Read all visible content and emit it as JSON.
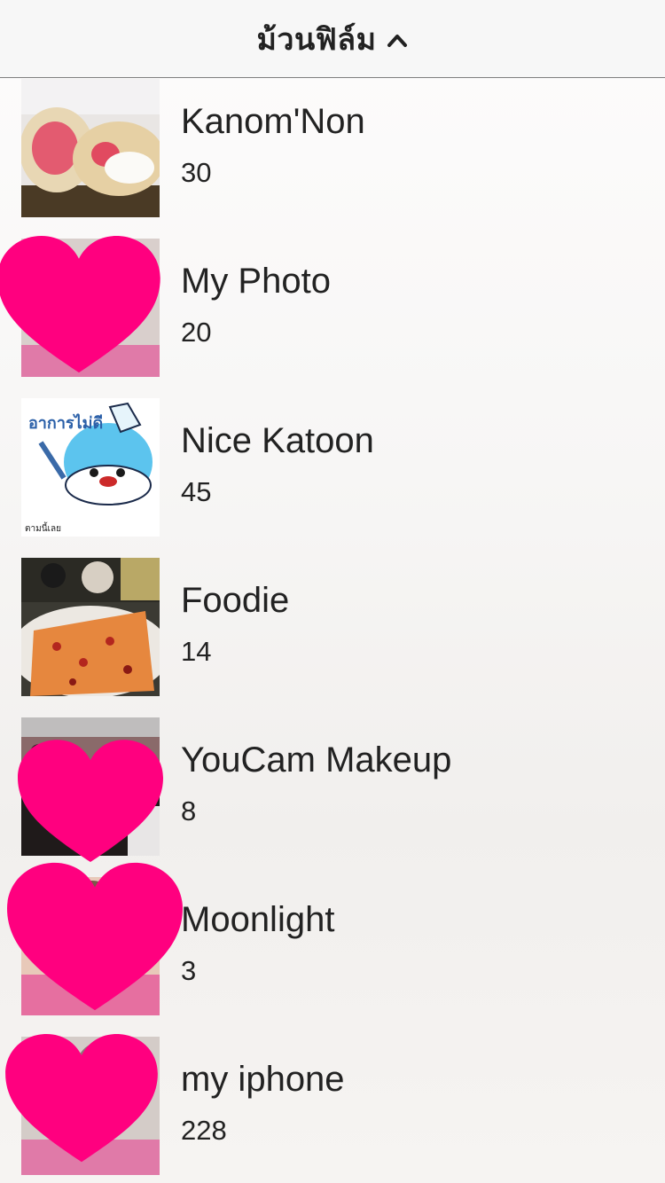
{
  "header": {
    "title": "ม้วนฟิล์ม",
    "chevron_icon": "chevron-up-icon"
  },
  "albums": [
    {
      "name": "Kanom'Non",
      "count": "30",
      "thumb_icon": "cake-photo"
    },
    {
      "name": "My Photo",
      "count": "20",
      "thumb_icon": "portrait-photo"
    },
    {
      "name": "Nice Katoon",
      "count": "45",
      "thumb_icon": "cartoon-sticker",
      "sticker_text": "อาการไม่ดี",
      "sticker_caption": "ตามนี้เลย"
    },
    {
      "name": "Foodie",
      "count": "14",
      "thumb_icon": "fruitcake-photo"
    },
    {
      "name": "YouCam Makeup",
      "count": "8",
      "thumb_icon": "crowd-photo"
    },
    {
      "name": "Moonlight",
      "count": "3",
      "thumb_icon": "portrait-photo"
    },
    {
      "name": "my iphone",
      "count": "228",
      "thumb_icon": "portrait-photo"
    }
  ],
  "colors": {
    "heart": "#ff007f",
    "header_bg": "#f7f7f7",
    "text": "#222222"
  }
}
